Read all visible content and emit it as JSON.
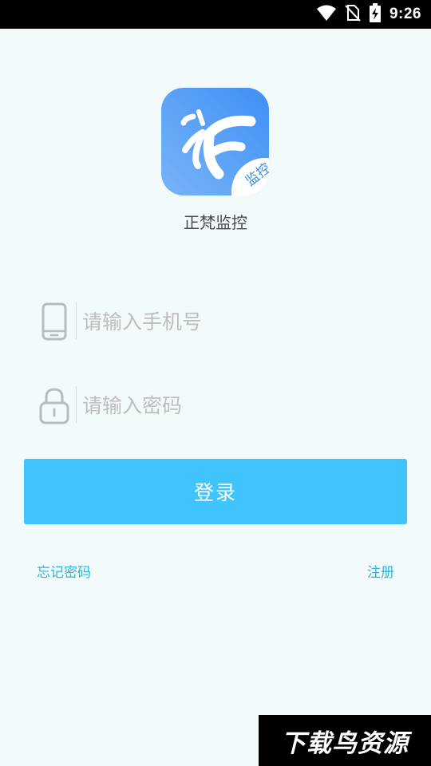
{
  "status_bar": {
    "time": "9:26",
    "icons": [
      "wifi-icon",
      "no-sim-icon",
      "battery-charging-icon"
    ]
  },
  "app": {
    "logo_badge": "监控",
    "name": "正梵监控",
    "brand_color": "#4a94f7"
  },
  "login_form": {
    "phone_placeholder": "请输入手机号",
    "password_placeholder": "请输入密码",
    "login_label": "登录",
    "accent_color": "#40c4fe"
  },
  "links": {
    "forgot_password": "忘记密码",
    "register": "注册"
  },
  "watermark": {
    "text": "下载鸟资源"
  }
}
